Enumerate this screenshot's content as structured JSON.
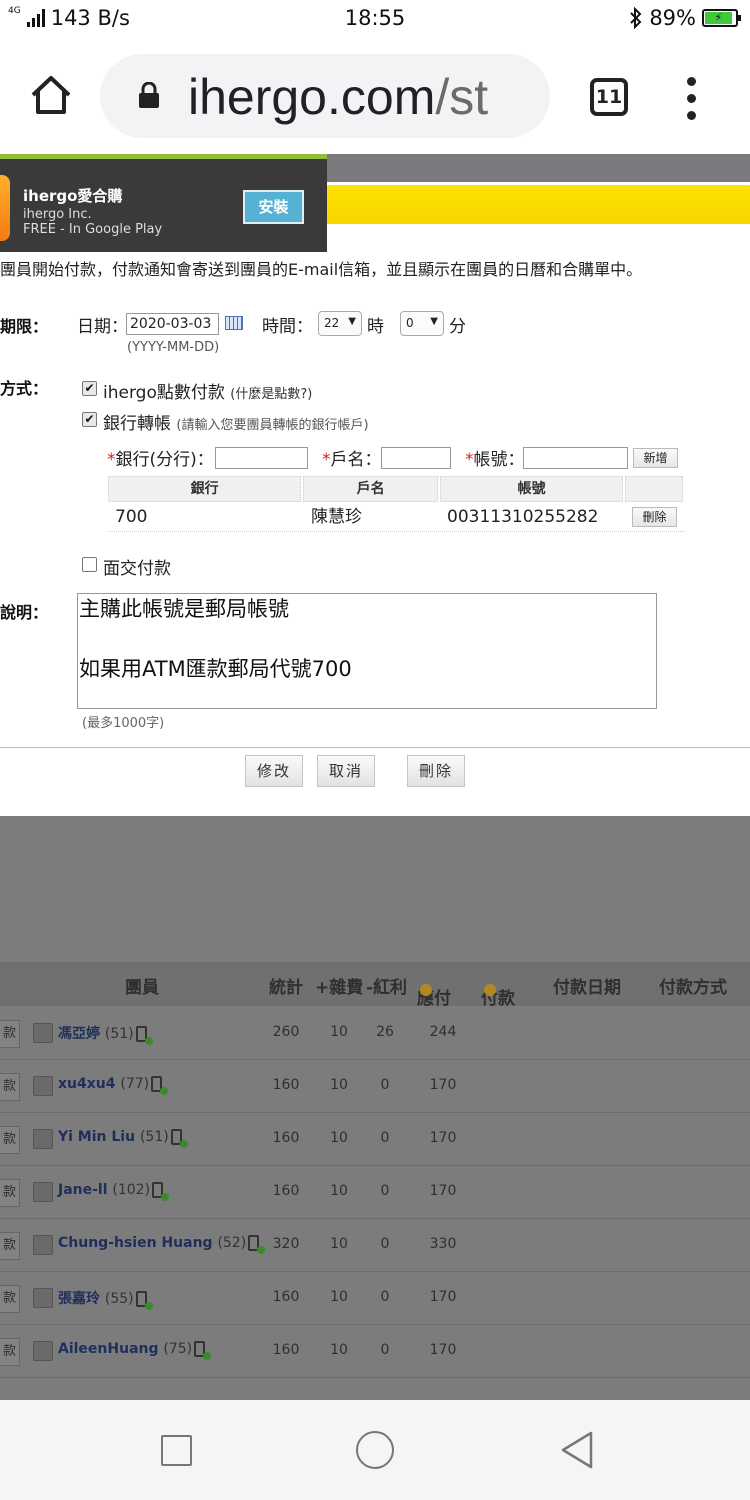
{
  "status_bar": {
    "network": "4G",
    "speed": "143 B/s",
    "time": "18:55",
    "battery": "89%"
  },
  "browser": {
    "url_domain": "ihergo.com",
    "url_path": "/st",
    "tab_count": "11"
  },
  "ad": {
    "title": "ihergo愛合購",
    "publisher": "ihergo Inc.",
    "store": "FREE - In Google Play",
    "install_label": "安裝"
  },
  "notice": "團員開始付款，付款通知會寄送到團員的E-mail信箱，並且顯示在團員的日曆和合購單中。",
  "deadline": {
    "label": "期限：",
    "date_label": "日期：",
    "date_value": "2020-03-03",
    "date_format": "(YYYY-MM-DD)",
    "time_label": "時間：",
    "hour_value": "22",
    "hour_unit": "時",
    "minute_value": "0",
    "minute_unit": "分"
  },
  "method": {
    "label": "方式：",
    "option_points": "ihergo點數付款",
    "points_help": "(什麼是點數?)",
    "option_bank": "銀行轉帳",
    "bank_help": "(請輸入您要團員轉帳的銀行帳戶)",
    "bank_field": "銀行(分行)：",
    "name_field": "戶名：",
    "account_field": "帳號：",
    "add_label": "新增",
    "option_face": "面交付款"
  },
  "bank_table": {
    "headers": [
      "銀行",
      "戶名",
      "帳號"
    ],
    "rows": [
      {
        "bank": "700",
        "name": "陳慧珍",
        "account": "00311310255282",
        "action": "刪除"
      }
    ]
  },
  "description": {
    "label": "說明：",
    "lines": [
      "主購此帳號是郵局帳號",
      "",
      "如果用ATM匯款郵局代號700"
    ],
    "limit": "(最多1000字)"
  },
  "actions": {
    "modify": "修改",
    "cancel": "取消",
    "delete": "刪除"
  },
  "member_list": {
    "headers": [
      "團員",
      "統計",
      "+雜費",
      "-紅利",
      "應付",
      "付款",
      "付款日期",
      "付款方式"
    ],
    "pay_button": "款",
    "rows": [
      {
        "name": "馮亞婷",
        "count": "(51)",
        "total": "260",
        "fee": "10",
        "bonus": "26",
        "due": "244"
      },
      {
        "name": "xu4xu4",
        "count": "(77)",
        "total": "160",
        "fee": "10",
        "bonus": "0",
        "due": "170"
      },
      {
        "name": "Yi Min Liu",
        "count": "(51)",
        "total": "160",
        "fee": "10",
        "bonus": "0",
        "due": "170"
      },
      {
        "name": "Jane-ll",
        "count": "(102)",
        "total": "160",
        "fee": "10",
        "bonus": "0",
        "due": "170"
      },
      {
        "name": "Chung-hsien Huang",
        "count": "(52)",
        "total": "320",
        "fee": "10",
        "bonus": "0",
        "due": "330"
      },
      {
        "name": "張嘉玲",
        "count": "(55)",
        "total": "160",
        "fee": "10",
        "bonus": "0",
        "due": "170"
      },
      {
        "name": "AileenHuang",
        "count": "(75)",
        "total": "160",
        "fee": "10",
        "bonus": "0",
        "due": "170"
      }
    ]
  },
  "colors": {
    "accent_yellow": "#ffe300",
    "ad_green": "#8fbd3a",
    "install_blue": "#56b2d4",
    "battery_green": "#3ec83a"
  }
}
